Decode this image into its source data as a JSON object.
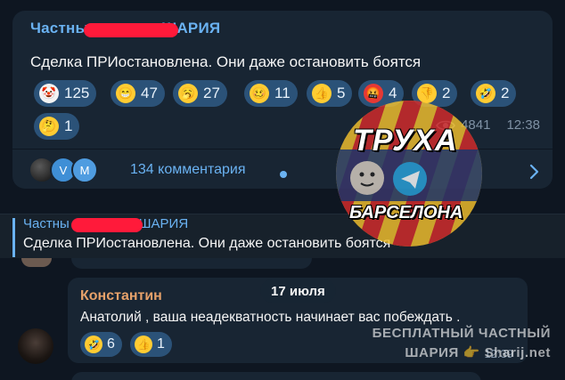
{
  "post": {
    "channel_visible_start": "Частны",
    "channel_visible_end": "ШАРИЯ",
    "text": "Сделка ПРИостановлена. Они даже остановить боятся",
    "reactions": [
      {
        "icon": "clown-face-icon",
        "count": "125"
      },
      {
        "icon": "grinning-face-icon",
        "count": "47"
      },
      {
        "icon": "yawning-face-icon",
        "count": "27"
      },
      {
        "icon": "woozy-face-icon",
        "count": "11"
      },
      {
        "icon": "thumbs-up-icon",
        "count": "5"
      },
      {
        "icon": "cursing-face-icon",
        "count": "4"
      },
      {
        "icon": "thumbs-down-icon",
        "count": "2"
      },
      {
        "icon": "rolling-laughing-face-icon",
        "count": "2"
      },
      {
        "icon": "thinking-face-icon",
        "count": "1"
      }
    ],
    "views": "4841",
    "time": "12:38",
    "comment_avatars": [
      "",
      "V",
      "M"
    ],
    "comments_label": "134 комментария"
  },
  "quote": {
    "channel_visible_start": "Частны",
    "channel_visible_end": "ШАРИЯ",
    "text": "Сделка ПРИостановлена. Они даже остановить боятся"
  },
  "date_separator": "17 июля",
  "comment": {
    "author": "Константин",
    "text": "Анатолий , ваша неадекватность начинает вас побеждать .",
    "reactions": [
      {
        "icon": "rolling-laughing-face-icon",
        "count": "6"
      },
      {
        "icon": "thumbs-up-icon",
        "count": "1"
      }
    ],
    "time": "12:39"
  },
  "watermark": {
    "title": "ТРУХА",
    "subtitle": "БАРСЕЛОНА",
    "line1": "БЕСПЛАТНЫЙ ЧАСТНЫЙ",
    "line2": "ШАРИЯ 👉 Sharij.net"
  },
  "colors": {
    "background": "#0e1621",
    "bubble": "#182533",
    "reaction_pill": "#2b5278",
    "link_blue": "#6ab2f2",
    "redaction_red": "#ff1a3a",
    "author_orange": "#e6a16a"
  }
}
